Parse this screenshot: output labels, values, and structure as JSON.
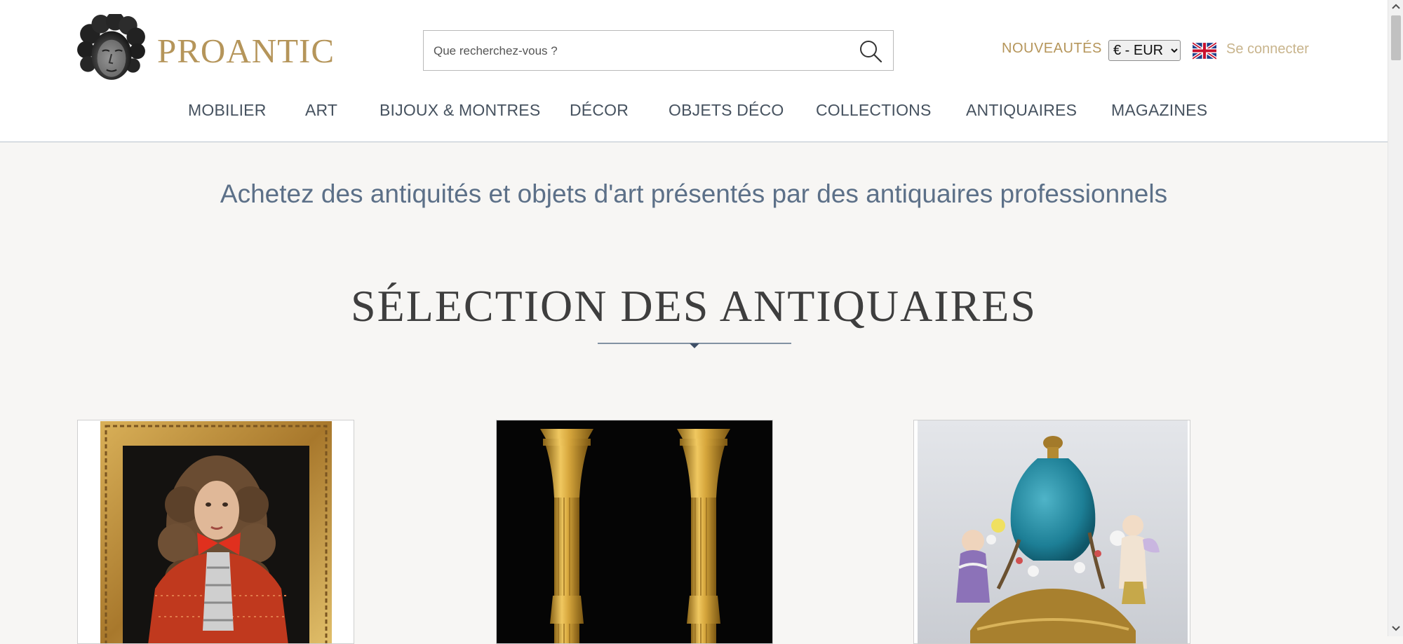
{
  "header": {
    "logo_text": "PROANTIC",
    "search_placeholder": "Que recherchez-vous ?",
    "nouveautes": "NOUVEAUTÉS",
    "currency_selected": "€ - EUR",
    "language_icon": "uk-flag-icon",
    "login": "Se connecter"
  },
  "nav": {
    "items": [
      {
        "label": "MOBILIER"
      },
      {
        "label": "ART"
      },
      {
        "label": "BIJOUX & MONTRES"
      },
      {
        "label": "DÉCOR"
      },
      {
        "label": "OBJETS DÉCO"
      },
      {
        "label": "COLLECTIONS"
      },
      {
        "label": "ANTIQUAIRES"
      },
      {
        "label": "MAGAZINES"
      }
    ]
  },
  "main": {
    "tagline": "Achetez des antiquités et objets d'art présentés par des antiquaires professionnels",
    "section_title": "SÉLECTION DES ANTIQUAIRES",
    "products": [
      {
        "image": "portrait-painting-image"
      },
      {
        "image": "gilt-candlesticks-image"
      },
      {
        "image": "porcelain-vase-image"
      }
    ]
  },
  "colors": {
    "gold": "#b5955a",
    "nav_text": "#46525f",
    "tagline": "#5c7088",
    "background": "#f7f6f4"
  }
}
